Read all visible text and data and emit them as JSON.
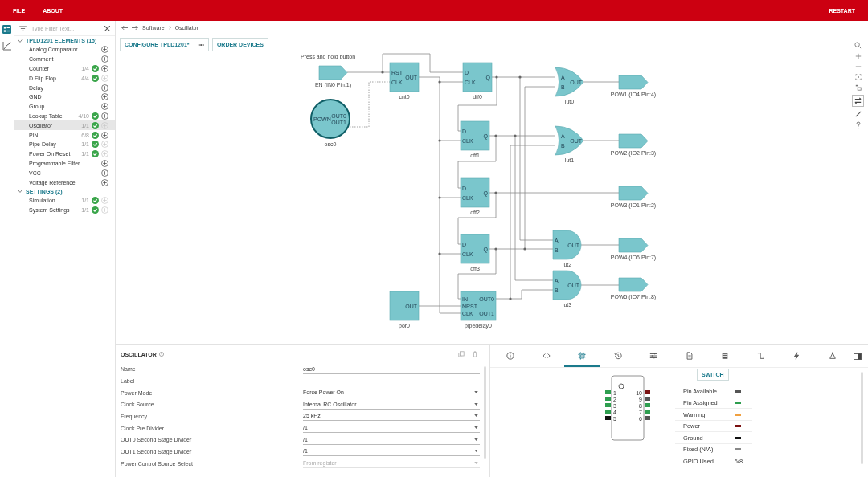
{
  "menu": [
    "FILE",
    "ABOUT"
  ],
  "restart": "RESTART",
  "filter": {
    "placeholder": "Type Filter Text..."
  },
  "groups": [
    {
      "title": "TPLD1201 ELEMENTS (15)",
      "expanded": true,
      "items": [
        {
          "label": "Analog Comparator",
          "done": false,
          "can_add": true,
          "selected": false
        },
        {
          "label": "Comment",
          "done": false,
          "can_add": true,
          "selected": false
        },
        {
          "label": "Counter",
          "count": "1/4",
          "done": true,
          "can_add": true,
          "selected": false
        },
        {
          "label": "D Flip Flop",
          "count": "4/4",
          "done": true,
          "can_add": false,
          "selected": false
        },
        {
          "label": "Delay",
          "done": false,
          "can_add": true,
          "selected": false
        },
        {
          "label": "GND",
          "done": false,
          "can_add": true,
          "selected": false
        },
        {
          "label": "Group",
          "done": false,
          "can_add": true,
          "selected": false
        },
        {
          "label": "Lookup Table",
          "count": "4/10",
          "done": true,
          "can_add": true,
          "selected": false
        },
        {
          "label": "Oscillator",
          "count": "1/1",
          "done": true,
          "can_add": false,
          "selected": true
        },
        {
          "label": "PIN",
          "count": "6/8",
          "done": true,
          "can_add": true,
          "selected": false
        },
        {
          "label": "Pipe Delay",
          "count": "1/1",
          "done": true,
          "can_add": false,
          "selected": false
        },
        {
          "label": "Power On Reset",
          "count": "1/1",
          "done": true,
          "can_add": false,
          "selected": false
        },
        {
          "label": "Programmable Filter",
          "done": false,
          "can_add": true,
          "selected": false
        },
        {
          "label": "VCC",
          "done": false,
          "can_add": true,
          "selected": false
        },
        {
          "label": "Voltage Reference",
          "done": false,
          "can_add": true,
          "selected": false
        }
      ]
    },
    {
      "title": "SETTINGS (2)",
      "expanded": true,
      "items": [
        {
          "label": "Simulation",
          "count": "1/1",
          "done": true,
          "can_add": false,
          "selected": false
        },
        {
          "label": "System Settings",
          "count": "1/1",
          "done": true,
          "can_add": false,
          "selected": false
        }
      ]
    }
  ],
  "breadcrumb": [
    "Software",
    "Oscillator"
  ],
  "toolbar": {
    "configure": "CONFIGURE TPLD1201*",
    "more": "•••",
    "order": "ORDER DEVICES"
  },
  "schematic": {
    "note": "Press and hold button",
    "nodes": [
      {
        "kind": "input",
        "label": "EN (IN0 Pin:1)"
      },
      {
        "kind": "osc",
        "label": "osc0",
        "pins_left": [
          "POWN"
        ],
        "pins_right": [
          "OUT0",
          "OUT1"
        ]
      },
      {
        "kind": "block",
        "label": "cnt0",
        "pins_left": [
          "RST",
          "CLK"
        ],
        "pins_right": [
          "OUT"
        ]
      },
      {
        "kind": "block",
        "label": "dff0",
        "pins_left": [
          "D",
          "CLK"
        ],
        "pins_right": [
          "Q"
        ]
      },
      {
        "kind": "block",
        "label": "dff1",
        "pins_left": [
          "D",
          "CLK"
        ],
        "pins_right": [
          "Q"
        ]
      },
      {
        "kind": "block",
        "label": "dff2",
        "pins_left": [
          "D",
          "CLK"
        ],
        "pins_right": [
          "Q"
        ]
      },
      {
        "kind": "block",
        "label": "dff3",
        "pins_left": [
          "D",
          "CLK"
        ],
        "pins_right": [
          "Q"
        ]
      },
      {
        "kind": "block",
        "label": "por0",
        "pins_right": [
          "OUT"
        ]
      },
      {
        "kind": "block",
        "label": "pipedelay0",
        "pins_left": [
          "IN",
          "NRST",
          "CLK"
        ],
        "pins_right": [
          "OUT0",
          "OUT1"
        ]
      },
      {
        "kind": "or",
        "label": "lut0",
        "pins_left": [
          "A",
          "B"
        ],
        "pins_right": [
          "OUT"
        ]
      },
      {
        "kind": "or",
        "label": "lut1",
        "pins_left": [
          "A",
          "B"
        ],
        "pins_right": [
          "OUT"
        ]
      },
      {
        "kind": "and",
        "label": "lut2",
        "pins_left": [
          "A",
          "B"
        ],
        "pins_right": [
          "OUT"
        ]
      },
      {
        "kind": "and",
        "label": "lut3",
        "pins_left": [
          "A",
          "B"
        ],
        "pins_right": [
          "OUT"
        ]
      },
      {
        "kind": "output",
        "label": "POW1 (IO4 Pin:4)"
      },
      {
        "kind": "output",
        "label": "POW2 (IO2 Pin:3)"
      },
      {
        "kind": "output",
        "label": "POW3 (IO1 Pin:2)"
      },
      {
        "kind": "output",
        "label": "POW4 (IO6 Pin:7)"
      },
      {
        "kind": "output",
        "label": "POW5 (IO7 Pin:8)"
      }
    ]
  },
  "properties": {
    "title": "OSCILLATOR",
    "fields": [
      {
        "label": "Name",
        "kind": "text",
        "value": "osc0",
        "disabled": false
      },
      {
        "label": "Label",
        "kind": "text",
        "disabled": false
      },
      {
        "label": "Power Mode",
        "kind": "select",
        "value": "Force Power On",
        "disabled": false
      },
      {
        "label": "Clock Source",
        "kind": "select",
        "value": "Internal RC Oscillator",
        "disabled": false
      },
      {
        "label": "Frequency",
        "kind": "select",
        "value": "25 kHz",
        "disabled": false
      },
      {
        "label": "Clock Pre Divider",
        "kind": "select",
        "value": "/1",
        "disabled": false
      },
      {
        "label": "OUT0 Second Stage Divider",
        "kind": "select",
        "value": "/1",
        "disabled": false
      },
      {
        "label": "OUT1 Second Stage Divider",
        "kind": "select",
        "value": "/1",
        "disabled": false
      },
      {
        "label": "Power Control Source Select",
        "kind": "select",
        "value": "From register",
        "disabled": true
      }
    ]
  },
  "tabs": [
    {
      "kind": "info",
      "selected": false
    },
    {
      "kind": "code",
      "selected": false
    },
    {
      "kind": "chip",
      "selected": true
    },
    {
      "kind": "history",
      "selected": false
    },
    {
      "kind": "sliders",
      "selected": false
    },
    {
      "kind": "document",
      "selected": false
    },
    {
      "kind": "memory",
      "selected": false
    },
    {
      "kind": "pulse",
      "selected": false
    },
    {
      "kind": "bolt",
      "selected": false
    },
    {
      "kind": "network",
      "selected": false
    }
  ],
  "switch": "SWITCH",
  "chip": {
    "left_pins": [
      {
        "number": "1",
        "color": "#2e9e4f"
      },
      {
        "number": "2",
        "color": "#2e9e4f"
      },
      {
        "number": "3",
        "color": "#2e9e4f"
      },
      {
        "number": "4",
        "color": "#2e9e4f"
      },
      {
        "number": "5",
        "color": "#111111"
      }
    ],
    "right_pins": [
      {
        "number": "10",
        "color": "#7a1010"
      },
      {
        "number": "9",
        "color": "#555555"
      },
      {
        "number": "8",
        "color": "#2e9e4f"
      },
      {
        "number": "7",
        "color": "#2e9e4f"
      },
      {
        "number": "6",
        "color": "#555555"
      }
    ]
  },
  "legend": [
    {
      "label": "Pin Available",
      "color": "#555555"
    },
    {
      "label": "Pin Assigned",
      "color": "#2e9e4f"
    },
    {
      "label": "Warning",
      "color": "#f0a040"
    },
    {
      "label": "Power",
      "color": "#7a1010"
    },
    {
      "label": "Ground",
      "color": "#111111"
    },
    {
      "label": "Fixed (N/A)",
      "color": "#888888"
    }
  ],
  "gpio_used": {
    "label": "GPIO Used",
    "value": "6/8"
  }
}
